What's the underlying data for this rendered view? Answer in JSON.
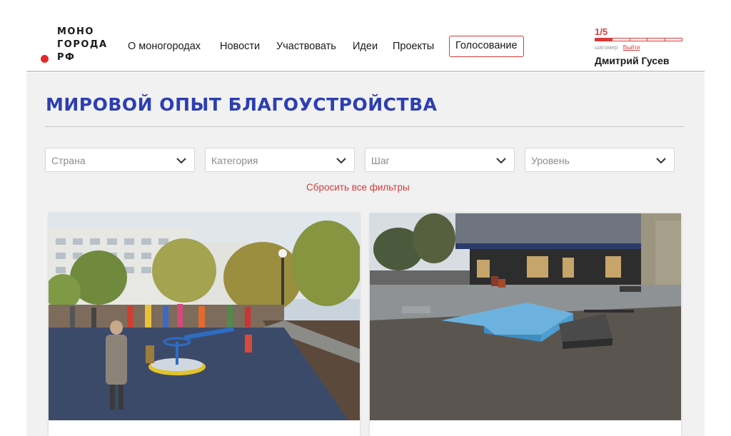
{
  "logo": {
    "lines": [
      "МОНО",
      "ГОРОДА",
      "РФ"
    ]
  },
  "nav": {
    "items": [
      {
        "label": "О моногородах"
      },
      {
        "label": "Новости"
      },
      {
        "label": "Участвовать"
      },
      {
        "label": "Идеи"
      },
      {
        "label": "Проекты"
      },
      {
        "label": "Голосование",
        "active": true
      }
    ]
  },
  "stepper": {
    "count": "1/5",
    "current": 1,
    "total": 5,
    "caption": "шагомер",
    "logout_label": "Выйти"
  },
  "user": {
    "name": "Дмитрий Гусев"
  },
  "page": {
    "title": "МИРОВОЙ ОПЫТ БЛАГОУСТРОЙСТВА"
  },
  "filters": [
    {
      "placeholder": "Страна"
    },
    {
      "placeholder": "Категория"
    },
    {
      "placeholder": "Шаг"
    },
    {
      "placeholder": "Уровень"
    }
  ],
  "reset_label": "Сбросить все фильтры",
  "colors": {
    "accent_red": "#d93a3a",
    "title_blue": "#2d3fb0",
    "content_bg": "#f1f1f1"
  },
  "cards": [
    {
      "image": "playground-photo"
    },
    {
      "image": "skatepark-photo"
    }
  ]
}
